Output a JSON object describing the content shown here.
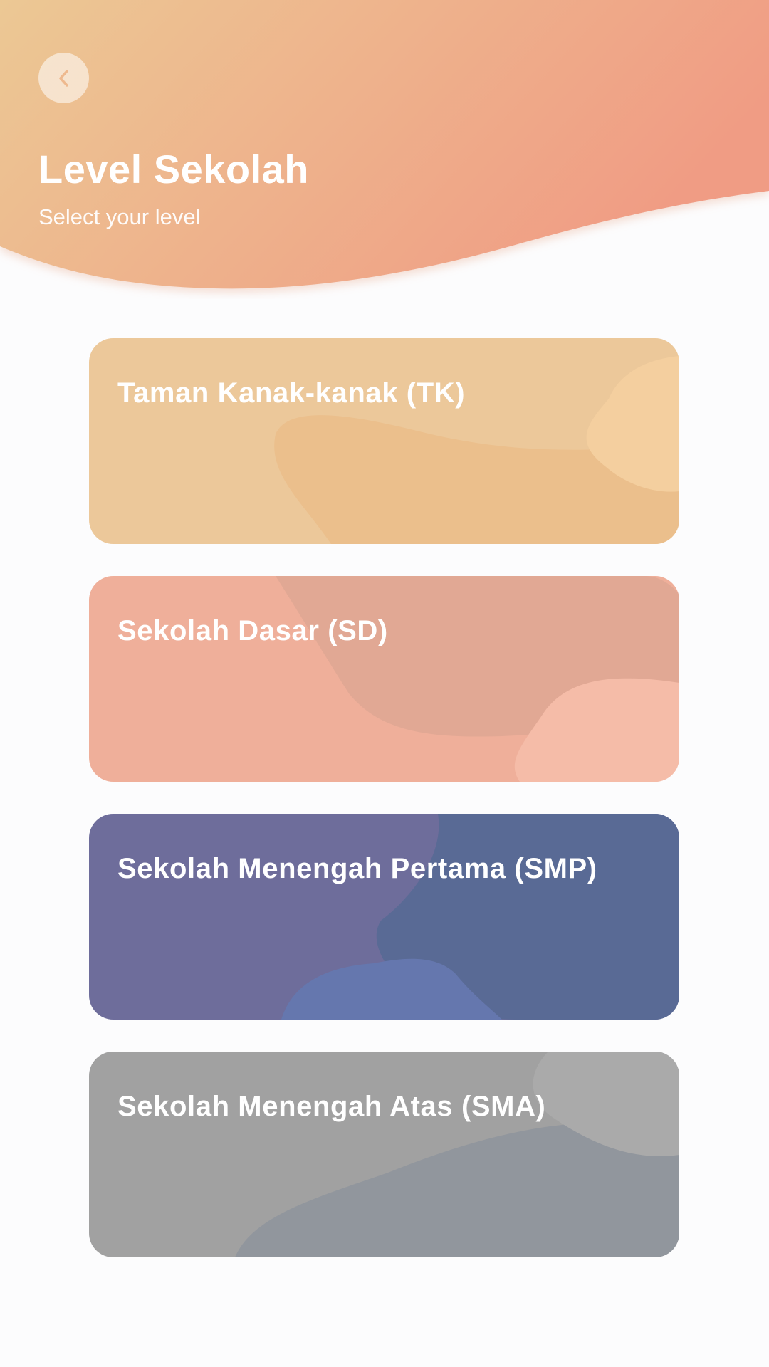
{
  "header": {
    "title": "Level Sekolah",
    "subtitle": "Select your level",
    "back_icon": "chevron-left-icon",
    "gradient": [
      "#ecc894",
      "#f09c84"
    ]
  },
  "levels": [
    {
      "id": "tk",
      "label": "Taman Kanak-kanak (TK)",
      "color": "#ecc89a",
      "blob1": "#ebbf8c",
      "blob2": "#f4cf9f"
    },
    {
      "id": "sd",
      "label": "Sekolah Dasar (SD)",
      "color": "#efaf9a",
      "blob1": "#e1a894",
      "blob2": "#f5bca8"
    },
    {
      "id": "smp",
      "label": "Sekolah Menengah Pertama (SMP)",
      "color": "#6e6d9b",
      "blob1": "#596a95",
      "blob2": "#6577ae"
    },
    {
      "id": "sma",
      "label": "Sekolah Menengah Atas (SMA)",
      "color": "#a1a1a1",
      "blob1": "#91969d",
      "blob2": "#aaaaaa"
    }
  ]
}
